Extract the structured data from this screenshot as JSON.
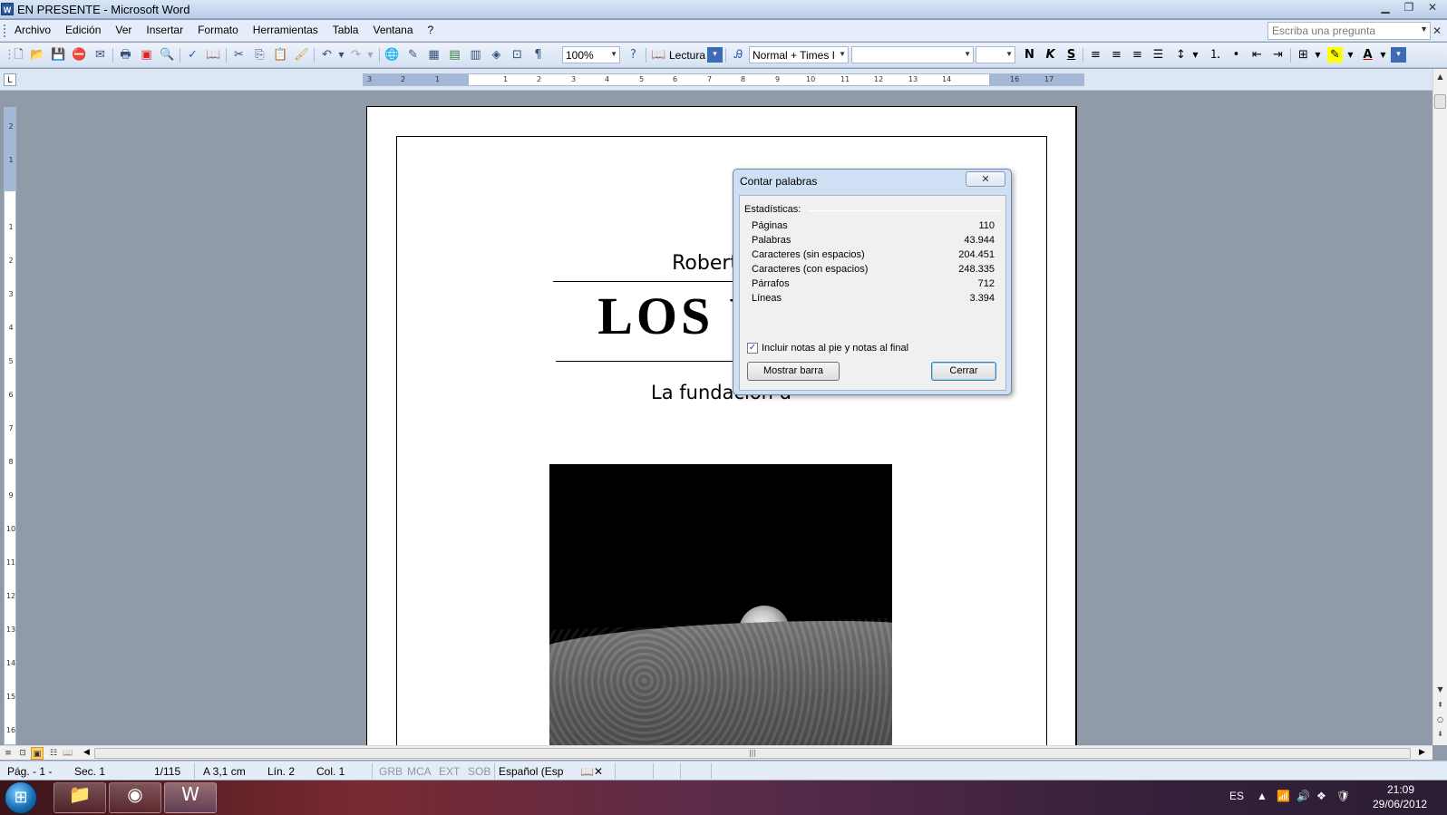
{
  "window": {
    "title": "EN PRESENTE - Microsoft Word",
    "app_icon": "W",
    "controls": [
      "minimize-icon",
      "restore-icon",
      "close-icon"
    ]
  },
  "menu": {
    "items": [
      "Archivo",
      "Edición",
      "Ver",
      "Insertar",
      "Formato",
      "Herramientas",
      "Tabla",
      "Ventana",
      "?"
    ],
    "help_placeholder": "Escriba una pregunta"
  },
  "toolbar": {
    "zoom": "100%",
    "reading_label": "Lectura",
    "style_value": "Normal + Times I",
    "font_value": "",
    "size_value": "",
    "bold_label": "N",
    "italic_label": "K",
    "underline_label": "S"
  },
  "ruler": {
    "labels": [
      "3",
      "2",
      "1",
      "1",
      "2",
      "3",
      "4",
      "5",
      "6",
      "7",
      "8",
      "9",
      "10",
      "11",
      "12",
      "13",
      "14",
      "16",
      "17"
    ],
    "vertical_labels": [
      "2",
      "1",
      "1",
      "2",
      "3",
      "4",
      "5",
      "6",
      "7",
      "8",
      "9",
      "10",
      "11",
      "12",
      "13",
      "14",
      "15",
      "16"
    ]
  },
  "document": {
    "author_visible": "Roberto C",
    "title_visible": "LOS VAL",
    "subtitle_visible": "La fundación d"
  },
  "dialog": {
    "title": "Contar palabras",
    "section_label": "Estadísticas:",
    "stats": [
      {
        "label": "Páginas",
        "value": "110"
      },
      {
        "label": "Palabras",
        "value": "43.944"
      },
      {
        "label": "Caracteres (sin espacios)",
        "value": "204.451"
      },
      {
        "label": "Caracteres (con espacios)",
        "value": "248.335"
      },
      {
        "label": "Párrafos",
        "value": "712"
      },
      {
        "label": "Líneas",
        "value": "3.394"
      }
    ],
    "checkbox_label": "Incluir notas al pie y notas al final",
    "checkbox_checked": true,
    "show_bar_button": "Mostrar barra",
    "close_button": "Cerrar"
  },
  "status": {
    "page": "Pág. - 1 -",
    "section": "Sec. 1",
    "page_count": "1/115",
    "at": "A 3,1 cm",
    "line": "Lín. 2",
    "col": "Col. 1",
    "grb": "GRB",
    "mca": "MCA",
    "ext": "EXT",
    "sob": "SOB",
    "language": "Español (Esp"
  },
  "taskbar": {
    "lang": "ES",
    "time": "21:09",
    "date": "29/06/2012"
  }
}
